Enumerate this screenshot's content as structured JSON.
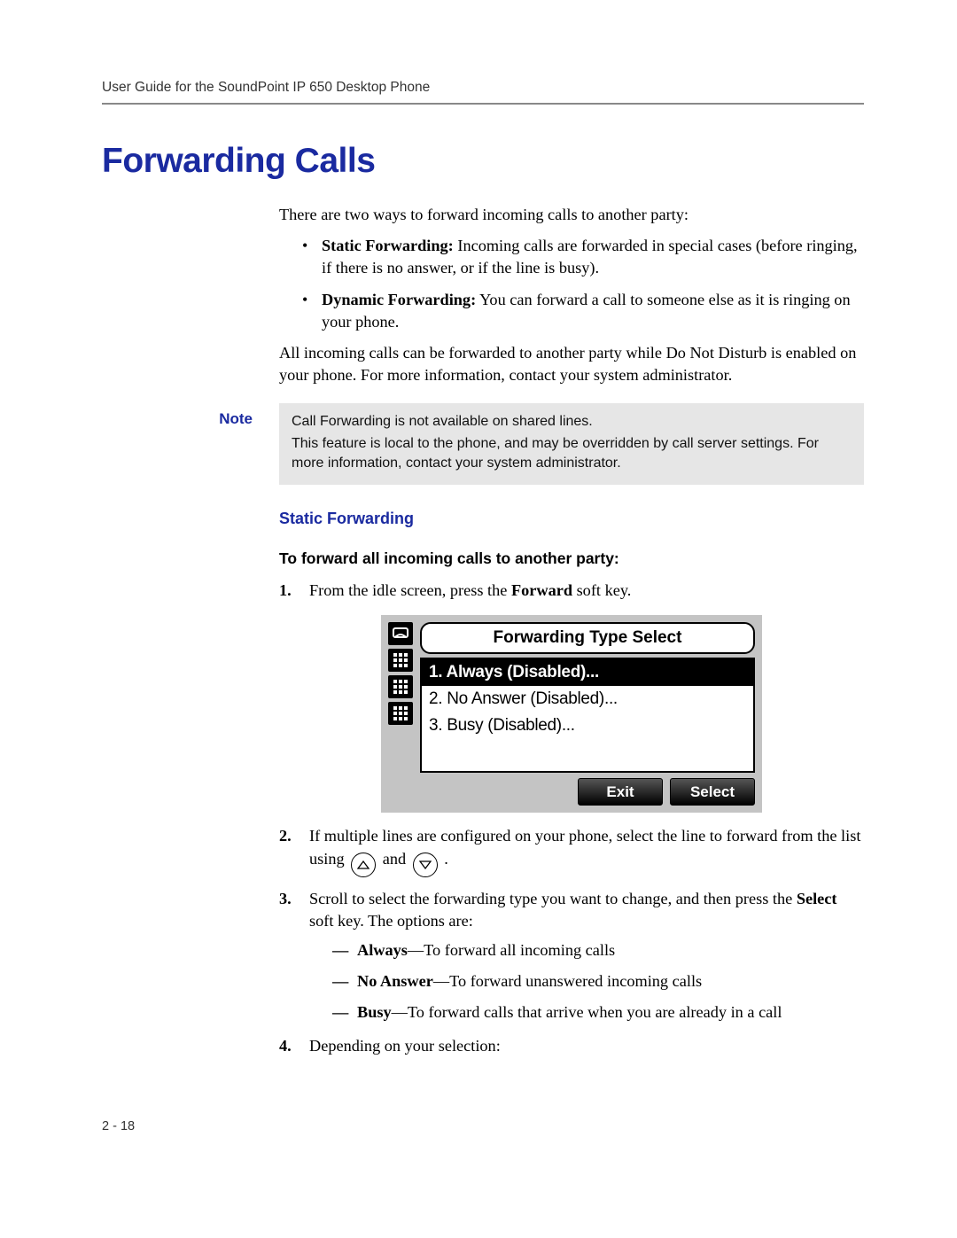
{
  "running_head": "User Guide for the SoundPoint IP 650 Desktop Phone",
  "title": "Forwarding Calls",
  "intro": "There are two ways to forward incoming calls to another party:",
  "bullets": {
    "b1_bold": "Static Forwarding:",
    "b1_rest": " Incoming calls are forwarded in special cases (before ringing, if there is no answer, or if the line is busy).",
    "b2_bold": "Dynamic Forwarding:",
    "b2_rest": " You can forward a call to someone else as it is ringing on your phone."
  },
  "para2": "All incoming calls can be forwarded to another party while Do Not Disturb is enabled on your phone. For more information, contact your system administrator.",
  "note": {
    "label": "Note",
    "line1": "Call Forwarding is not available on shared lines.",
    "line2": "This feature is local to the phone, and may be overridden by call server settings. For more information, contact your system administrator."
  },
  "subhead": "Static Forwarding",
  "proc_head": "To forward all incoming calls to another party:",
  "steps": {
    "s1a": "From the idle screen, press the ",
    "s1b": "Forward",
    "s1c": " soft key.",
    "s2a": "If multiple lines are configured on your phone, select the line to forward from the list using ",
    "s2b": " and ",
    "s2c": " .",
    "s3a": "Scroll to select the forwarding type you want to change, and then press the ",
    "s3b": "Select",
    "s3c": " soft key. The options are:",
    "s4": "Depending on your selection:"
  },
  "options": {
    "o1_bold": "Always",
    "o1_rest": "—To forward all incoming calls",
    "o2_bold": "No Answer",
    "o2_rest": "—To forward unanswered incoming calls",
    "o3_bold": "Busy",
    "o3_rest": "—To forward calls that arrive when you are already in a call"
  },
  "screen": {
    "title": "Forwarding Type Select",
    "item1": "1. Always (Disabled)...",
    "item2": "2. No Answer (Disabled)...",
    "item3": "3. Busy (Disabled)...",
    "soft_exit": "Exit",
    "soft_select": "Select"
  },
  "pagenum": "2 - 18"
}
